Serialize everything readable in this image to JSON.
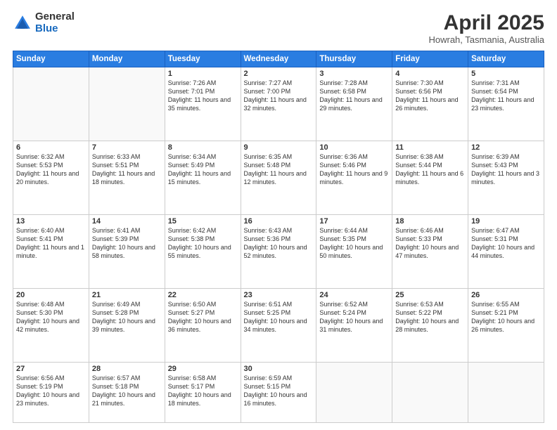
{
  "header": {
    "logo_general": "General",
    "logo_blue": "Blue",
    "month_title": "April 2025",
    "subtitle": "Howrah, Tasmania, Australia"
  },
  "days_of_week": [
    "Sunday",
    "Monday",
    "Tuesday",
    "Wednesday",
    "Thursday",
    "Friday",
    "Saturday"
  ],
  "weeks": [
    [
      {
        "day": "",
        "empty": true
      },
      {
        "day": "",
        "empty": true
      },
      {
        "day": "1",
        "sunrise": "7:26 AM",
        "sunset": "7:01 PM",
        "daylight": "11 hours and 35 minutes."
      },
      {
        "day": "2",
        "sunrise": "7:27 AM",
        "sunset": "7:00 PM",
        "daylight": "11 hours and 32 minutes."
      },
      {
        "day": "3",
        "sunrise": "7:28 AM",
        "sunset": "6:58 PM",
        "daylight": "11 hours and 29 minutes."
      },
      {
        "day": "4",
        "sunrise": "7:30 AM",
        "sunset": "6:56 PM",
        "daylight": "11 hours and 26 minutes."
      },
      {
        "day": "5",
        "sunrise": "7:31 AM",
        "sunset": "6:54 PM",
        "daylight": "11 hours and 23 minutes."
      }
    ],
    [
      {
        "day": "6",
        "sunrise": "6:32 AM",
        "sunset": "5:53 PM",
        "daylight": "11 hours and 20 minutes."
      },
      {
        "day": "7",
        "sunrise": "6:33 AM",
        "sunset": "5:51 PM",
        "daylight": "11 hours and 18 minutes."
      },
      {
        "day": "8",
        "sunrise": "6:34 AM",
        "sunset": "5:49 PM",
        "daylight": "11 hours and 15 minutes."
      },
      {
        "day": "9",
        "sunrise": "6:35 AM",
        "sunset": "5:48 PM",
        "daylight": "11 hours and 12 minutes."
      },
      {
        "day": "10",
        "sunrise": "6:36 AM",
        "sunset": "5:46 PM",
        "daylight": "11 hours and 9 minutes."
      },
      {
        "day": "11",
        "sunrise": "6:38 AM",
        "sunset": "5:44 PM",
        "daylight": "11 hours and 6 minutes."
      },
      {
        "day": "12",
        "sunrise": "6:39 AM",
        "sunset": "5:43 PM",
        "daylight": "11 hours and 3 minutes."
      }
    ],
    [
      {
        "day": "13",
        "sunrise": "6:40 AM",
        "sunset": "5:41 PM",
        "daylight": "11 hours and 1 minute."
      },
      {
        "day": "14",
        "sunrise": "6:41 AM",
        "sunset": "5:39 PM",
        "daylight": "10 hours and 58 minutes."
      },
      {
        "day": "15",
        "sunrise": "6:42 AM",
        "sunset": "5:38 PM",
        "daylight": "10 hours and 55 minutes."
      },
      {
        "day": "16",
        "sunrise": "6:43 AM",
        "sunset": "5:36 PM",
        "daylight": "10 hours and 52 minutes."
      },
      {
        "day": "17",
        "sunrise": "6:44 AM",
        "sunset": "5:35 PM",
        "daylight": "10 hours and 50 minutes."
      },
      {
        "day": "18",
        "sunrise": "6:46 AM",
        "sunset": "5:33 PM",
        "daylight": "10 hours and 47 minutes."
      },
      {
        "day": "19",
        "sunrise": "6:47 AM",
        "sunset": "5:31 PM",
        "daylight": "10 hours and 44 minutes."
      }
    ],
    [
      {
        "day": "20",
        "sunrise": "6:48 AM",
        "sunset": "5:30 PM",
        "daylight": "10 hours and 42 minutes."
      },
      {
        "day": "21",
        "sunrise": "6:49 AM",
        "sunset": "5:28 PM",
        "daylight": "10 hours and 39 minutes."
      },
      {
        "day": "22",
        "sunrise": "6:50 AM",
        "sunset": "5:27 PM",
        "daylight": "10 hours and 36 minutes."
      },
      {
        "day": "23",
        "sunrise": "6:51 AM",
        "sunset": "5:25 PM",
        "daylight": "10 hours and 34 minutes."
      },
      {
        "day": "24",
        "sunrise": "6:52 AM",
        "sunset": "5:24 PM",
        "daylight": "10 hours and 31 minutes."
      },
      {
        "day": "25",
        "sunrise": "6:53 AM",
        "sunset": "5:22 PM",
        "daylight": "10 hours and 28 minutes."
      },
      {
        "day": "26",
        "sunrise": "6:55 AM",
        "sunset": "5:21 PM",
        "daylight": "10 hours and 26 minutes."
      }
    ],
    [
      {
        "day": "27",
        "sunrise": "6:56 AM",
        "sunset": "5:19 PM",
        "daylight": "10 hours and 23 minutes."
      },
      {
        "day": "28",
        "sunrise": "6:57 AM",
        "sunset": "5:18 PM",
        "daylight": "10 hours and 21 minutes."
      },
      {
        "day": "29",
        "sunrise": "6:58 AM",
        "sunset": "5:17 PM",
        "daylight": "10 hours and 18 minutes."
      },
      {
        "day": "30",
        "sunrise": "6:59 AM",
        "sunset": "5:15 PM",
        "daylight": "10 hours and 16 minutes."
      },
      {
        "day": "",
        "empty": true
      },
      {
        "day": "",
        "empty": true
      },
      {
        "day": "",
        "empty": true
      }
    ]
  ],
  "labels": {
    "sunrise_prefix": "Sunrise: ",
    "sunset_prefix": "Sunset: ",
    "daylight_prefix": "Daylight: "
  }
}
